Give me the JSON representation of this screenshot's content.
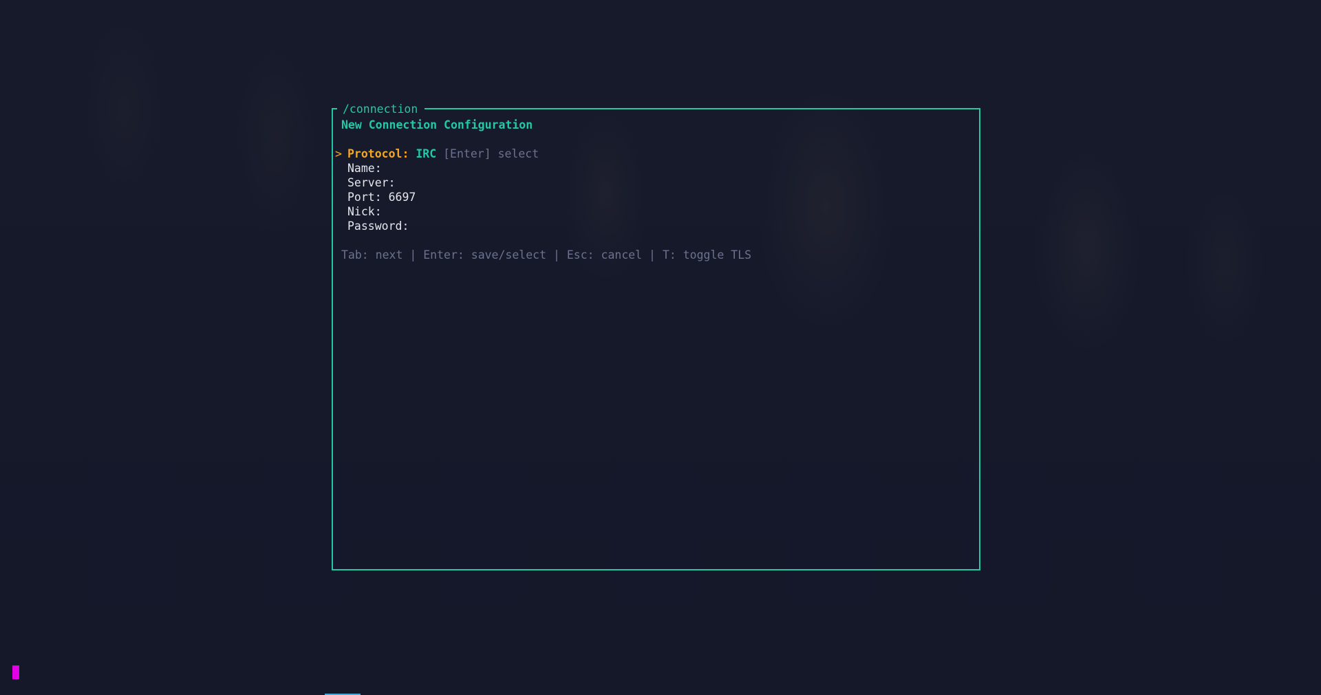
{
  "panel": {
    "title": "/connection",
    "heading": "New Connection Configuration"
  },
  "form": {
    "selected_marker": ">",
    "protocol": {
      "label": "Protocol:",
      "value": "IRC",
      "hint": "[Enter] select"
    },
    "name": {
      "label": "Name:",
      "value": ""
    },
    "server": {
      "label": "Server:",
      "value": ""
    },
    "port": {
      "label": "Port:",
      "value": "6697"
    },
    "nick": {
      "label": "Nick:",
      "value": ""
    },
    "password": {
      "label": "Password:",
      "value": ""
    }
  },
  "help": {
    "tab": "Tab: next",
    "enter": "Enter: save/select",
    "esc": "Esc: cancel",
    "tls": "T: toggle TLS",
    "separator": " | "
  },
  "colors": {
    "accent": "#21c9a6",
    "selected": "#f5a623",
    "muted": "#6c7290",
    "cursor": "#e400e4",
    "background": "#161a2b"
  }
}
